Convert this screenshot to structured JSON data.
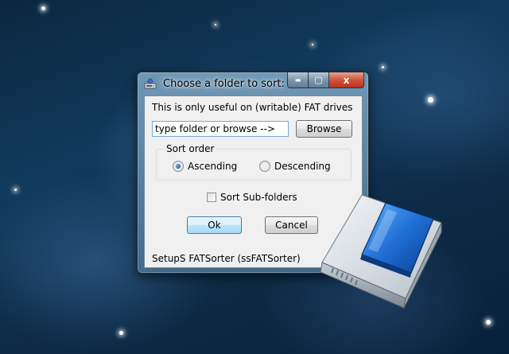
{
  "window": {
    "title": "Choose a folder to sort:",
    "controls": {
      "minimize": "▬",
      "maximize": "▢",
      "close": "x"
    }
  },
  "form": {
    "info_text": "This is only useful on (writable) FAT drives",
    "folder_input_value": "type folder or browse -->",
    "browse_label": "Browse",
    "sort_order": {
      "label": "Sort order",
      "options": [
        {
          "label": "Ascending",
          "selected": true
        },
        {
          "label": "Descending",
          "selected": false
        }
      ]
    },
    "sort_subfolders": {
      "label": "Sort Sub-folders",
      "checked": false
    },
    "ok_label": "Ok",
    "cancel_label": "Cancel",
    "status_text": "SetupS FATSorter (ssFATSorter)"
  },
  "icons": {
    "app": "drive-icon",
    "decoration": "hard-drive-illustration"
  }
}
